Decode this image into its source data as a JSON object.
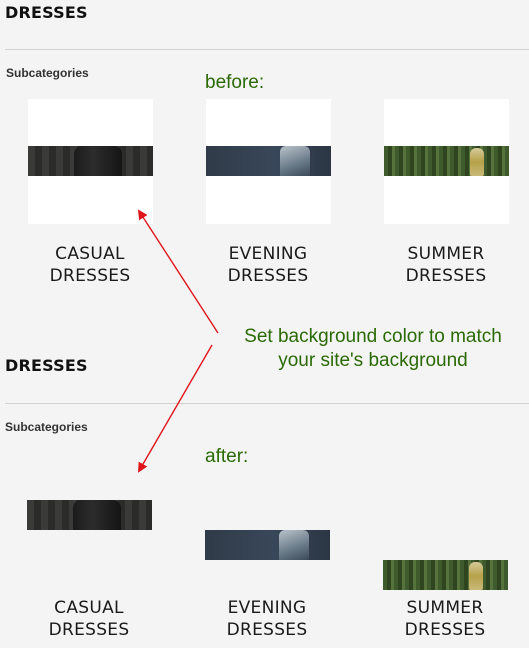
{
  "top": {
    "heading": "DRESSES",
    "subcategories": "Subcategories",
    "note": "before:"
  },
  "bottom": {
    "heading": "DRESSES",
    "subcategories": "Subcategories",
    "note": "after:"
  },
  "annotation": {
    "line1": "Set background color to match",
    "line2": "your site's background"
  },
  "items": [
    {
      "line1": "CASUAL",
      "line2": "DRESSES"
    },
    {
      "line1": "EVENING",
      "line2": "DRESSES"
    },
    {
      "line1": "SUMMER",
      "line2": "DRESSES"
    }
  ],
  "colors": {
    "annotation_text": "#2a6a06",
    "arrow": "#e0151b",
    "tile_background": "#ffffff"
  }
}
